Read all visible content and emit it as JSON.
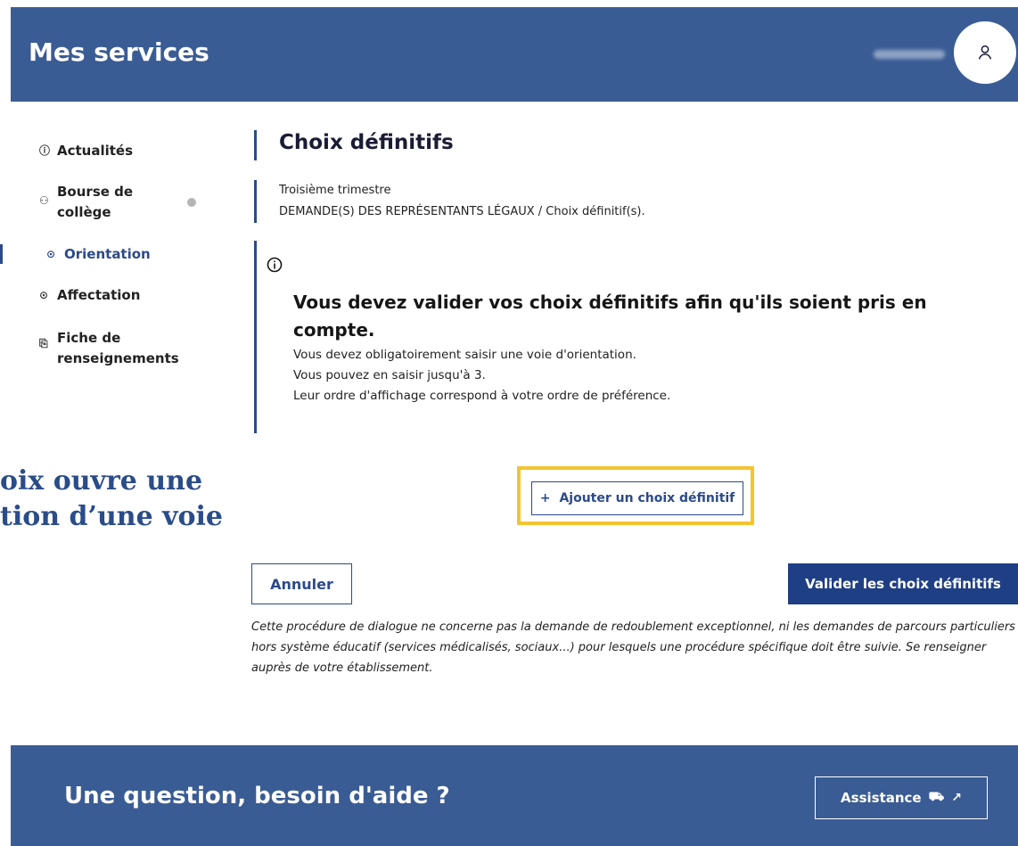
{
  "header": {
    "app_title": "Mes services"
  },
  "sidebar": {
    "items": [
      {
        "label": "Actualités",
        "icon": "info-circle-icon",
        "active": false
      },
      {
        "label": "Bourse de\ncollège",
        "icon": "people-icon",
        "active": false
      },
      {
        "label": "Orientation",
        "icon": "compass-icon",
        "active": true
      },
      {
        "label": "Affectation",
        "icon": "target-icon",
        "active": false
      },
      {
        "label": "Fiche de\nrenseignements",
        "icon": "document-icon",
        "active": false
      }
    ]
  },
  "main": {
    "title": "Choix définitifs",
    "breadcrumb": {
      "period": "Troisième trimestre",
      "path": "DEMANDE(S) DES REPRÉSENTANTS LÉGAUX / Choix définitif(s)."
    },
    "notice": {
      "title": "Vous devez valider vos choix définitifs afin qu'ils soient pris en compte.",
      "lines": [
        "Vous devez obligatoirement saisir une voie d'orientation.",
        "Vous pouvez en saisir jusqu'à 3.",
        "Leur ordre d'affichage correspond à votre ordre de préférence."
      ]
    },
    "add_button": "Ajouter un choix définitif",
    "cancel_button": "Annuler",
    "validate_button": "Valider les choix définitifs",
    "disclaimer": "Cette procédure de dialogue ne concerne pas la demande de redoublement exceptionnel, ni les demandes de parcours particuliers hors système éducatif (services médicalisés, sociaux...) pour lesquels une procédure spécifique doit être suivie. Se renseigner auprès de votre établissement."
  },
  "caption": {
    "line1": "oix ouvre une",
    "line2": "tion d’une voie"
  },
  "footer": {
    "title": "Une question, besoin d'aide ?",
    "assistance_button": "Assistance"
  },
  "colors": {
    "header_bg": "#3a5c94",
    "accent": "#2c4a8a",
    "primary_button": "#1f3f85",
    "highlight": "#f4c430"
  }
}
